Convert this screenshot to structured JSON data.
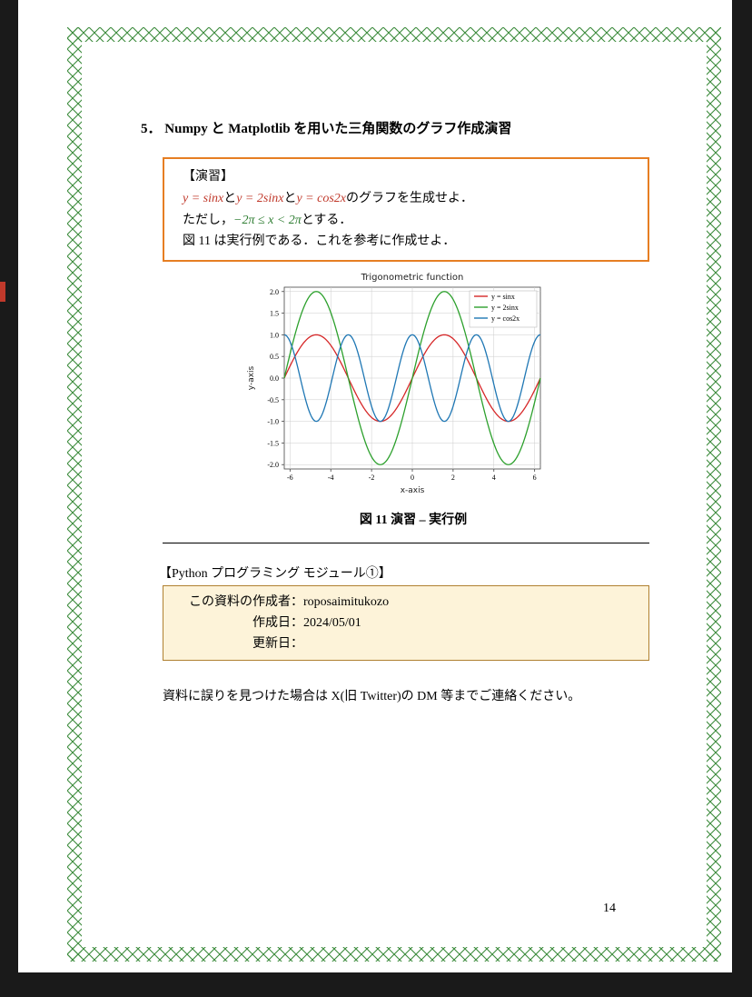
{
  "section": {
    "number": "5．",
    "title": "Numpy と Matplotlib を用いた三角関数のグラフ作成演習"
  },
  "exercise": {
    "label": "【演習】",
    "eq1": "y  =  sinx",
    "conj1": "と",
    "eq2": "y = 2sinx",
    "conj2": "と",
    "eq3": "y = cos2x",
    "tail1": "のグラフを生成せよ．",
    "line2a": "ただし，",
    "range": "−2π ≤  x  <  2π",
    "line2b": "とする．",
    "line3": "図 11 は実行例である．これを参考に作成せよ．"
  },
  "chart_data": {
    "type": "line",
    "title": "Trigonometric function",
    "xlabel": "x-axis",
    "ylabel": "y-axis",
    "xlim": [
      -6.283,
      6.283
    ],
    "ylim": [
      -2.1,
      2.1
    ],
    "xticks": [
      -6,
      -4,
      -2,
      0,
      2,
      4,
      6
    ],
    "yticks": [
      -2.0,
      -1.5,
      -1.0,
      -0.5,
      0.0,
      0.5,
      1.0,
      1.5,
      2.0
    ],
    "series": [
      {
        "name": "y = sinx",
        "color": "#d62728",
        "fn": "sin(x)"
      },
      {
        "name": "y = 2sinx",
        "color": "#2ca02c",
        "fn": "2*sin(x)"
      },
      {
        "name": "y = cos2x",
        "color": "#1f77b4",
        "fn": "cos(2*x)"
      }
    ],
    "legend_position": "upper right",
    "grid": true
  },
  "caption": "図 11  演習  –  実行例",
  "module_title": "【Python  プログラミング  モジュール①】",
  "author_box": {
    "rows": [
      {
        "label": "この資料の作成者",
        "value": "roposaimitukozo"
      },
      {
        "label": "作成日",
        "value": "2024/05/01"
      },
      {
        "label": "更新日",
        "value": ""
      }
    ]
  },
  "footnote": "資料に誤りを見つけた場合は  X(旧  Twitter)の  DM  等までご連絡ください。",
  "page_number": "14"
}
